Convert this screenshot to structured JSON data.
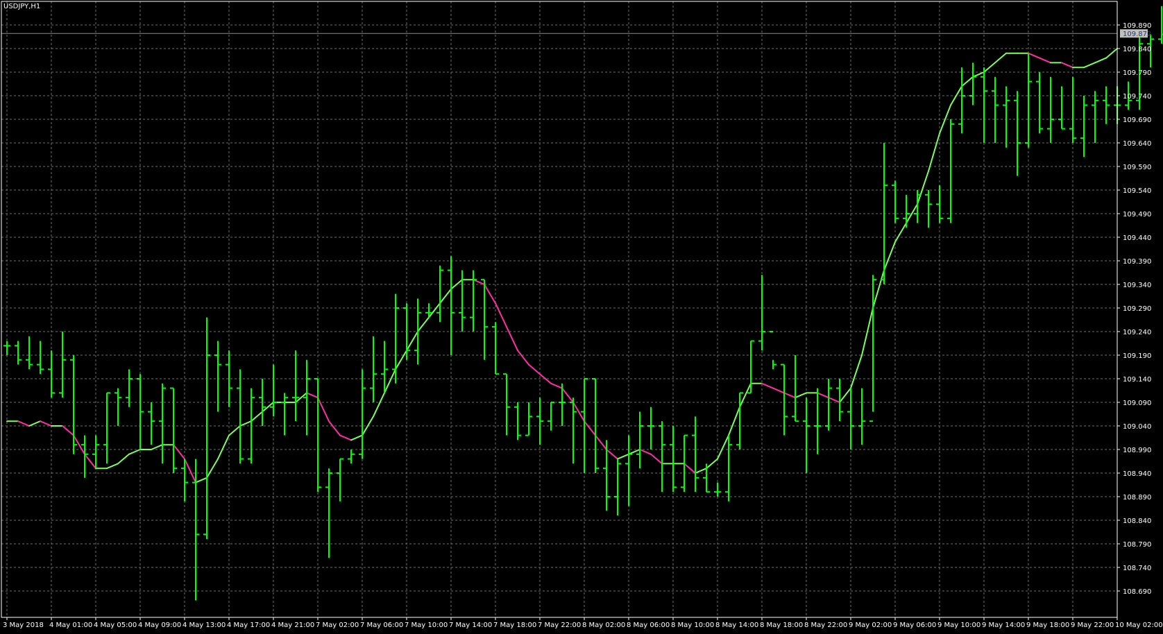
{
  "window": {
    "symbol_label": "USDJPY,H1"
  },
  "colors": {
    "background": "#000000",
    "frame": "#ffffff",
    "grid": "#6e6e6e",
    "bars": "#00ff00",
    "ma_rising": "#7cff5a",
    "ma_falling": "#ff2ea6",
    "price_line": "#8c8c8c",
    "price_tag_bg": "#c0c0c0",
    "price_tag_text": "#1e3a8a",
    "axis_text": "#ffffff"
  },
  "chart_data": {
    "type": "line",
    "subtype": "ohlc-bars-with-moving-average",
    "title": "USDJPY,H1",
    "xlabel": "",
    "ylabel": "",
    "grid": true,
    "ylim": [
      108.65,
      109.93
    ],
    "current_price": 109.872,
    "current_price_label": "109.872",
    "y_ticks": [
      "109.890",
      "109.840",
      "109.790",
      "109.740",
      "109.690",
      "109.640",
      "109.590",
      "109.540",
      "109.490",
      "109.440",
      "109.390",
      "109.340",
      "109.290",
      "109.240",
      "109.190",
      "109.140",
      "109.090",
      "109.040",
      "108.990",
      "108.940",
      "108.890",
      "108.840",
      "108.790",
      "108.740",
      "108.690"
    ],
    "x_ticks": [
      {
        "i": 0,
        "label": "3 May 2018"
      },
      {
        "i": 4,
        "label": "4 May 01:00"
      },
      {
        "i": 8,
        "label": "4 May 05:00"
      },
      {
        "i": 12,
        "label": "4 May 09:00"
      },
      {
        "i": 16,
        "label": "4 May 13:00"
      },
      {
        "i": 20,
        "label": "4 May 17:00"
      },
      {
        "i": 24,
        "label": "4 May 21:00"
      },
      {
        "i": 28,
        "label": "7 May 02:00"
      },
      {
        "i": 32,
        "label": "7 May 06:00"
      },
      {
        "i": 36,
        "label": "7 May 10:00"
      },
      {
        "i": 40,
        "label": "7 May 14:00"
      },
      {
        "i": 44,
        "label": "7 May 18:00"
      },
      {
        "i": 48,
        "label": "7 May 22:00"
      },
      {
        "i": 52,
        "label": "8 May 02:00"
      },
      {
        "i": 56,
        "label": "8 May 06:00"
      },
      {
        "i": 60,
        "label": "8 May 10:00"
      },
      {
        "i": 64,
        "label": "8 May 14:00"
      },
      {
        "i": 68,
        "label": "8 May 18:00"
      },
      {
        "i": 72,
        "label": "8 May 22:00"
      },
      {
        "i": 76,
        "label": "9 May 02:00"
      },
      {
        "i": 80,
        "label": "9 May 06:00"
      },
      {
        "i": 84,
        "label": "9 May 10:00"
      },
      {
        "i": 88,
        "label": "9 May 14:00"
      },
      {
        "i": 92,
        "label": "9 May 18:00"
      },
      {
        "i": 96,
        "label": "9 May 22:00"
      },
      {
        "i": 100,
        "label": "10 May 02:00"
      }
    ],
    "ohlc": [
      [
        109.21,
        109.22,
        109.19,
        109.21
      ],
      [
        109.21,
        109.22,
        109.17,
        109.18
      ],
      [
        109.18,
        109.23,
        109.16,
        109.17
      ],
      [
        109.17,
        109.22,
        109.15,
        109.16
      ],
      [
        109.16,
        109.2,
        109.1,
        109.11
      ],
      [
        109.11,
        109.24,
        109.1,
        109.18
      ],
      [
        109.18,
        109.19,
        108.98,
        109.0
      ],
      [
        109.0,
        109.02,
        108.93,
        108.98
      ],
      [
        108.98,
        109.02,
        108.95,
        109.0
      ],
      [
        109.0,
        109.11,
        108.96,
        109.11
      ],
      [
        109.11,
        109.12,
        109.04,
        109.1
      ],
      [
        109.1,
        109.16,
        109.08,
        109.14
      ],
      [
        109.14,
        109.15,
        108.99,
        109.07
      ],
      [
        109.07,
        109.09,
        109.0,
        109.05
      ],
      [
        109.05,
        109.13,
        108.96,
        109.12
      ],
      [
        109.12,
        109.12,
        108.94,
        108.95
      ],
      [
        108.95,
        108.97,
        108.88,
        108.92
      ],
      [
        108.92,
        108.97,
        108.67,
        108.81
      ],
      [
        108.81,
        109.27,
        108.8,
        109.19
      ],
      [
        109.19,
        109.22,
        109.07,
        109.17
      ],
      [
        109.17,
        109.2,
        109.08,
        109.12
      ],
      [
        109.12,
        109.16,
        108.96,
        108.97
      ],
      [
        108.97,
        109.12,
        108.96,
        109.1
      ],
      [
        109.1,
        109.14,
        109.04,
        109.08
      ],
      [
        109.08,
        109.17,
        109.06,
        109.09
      ],
      [
        109.09,
        109.11,
        109.02,
        109.1
      ],
      [
        109.1,
        109.2,
        109.05,
        109.1
      ],
      [
        109.1,
        109.18,
        109.02,
        109.14
      ],
      [
        109.14,
        109.14,
        108.9,
        108.91
      ],
      [
        108.91,
        108.95,
        108.76,
        108.94
      ],
      [
        108.94,
        108.97,
        108.88,
        108.97
      ],
      [
        108.97,
        108.99,
        108.96,
        108.98
      ],
      [
        108.98,
        109.16,
        108.97,
        109.12
      ],
      [
        109.12,
        109.23,
        109.09,
        109.15
      ],
      [
        109.15,
        109.22,
        109.11,
        109.16
      ],
      [
        109.16,
        109.32,
        109.13,
        109.29
      ],
      [
        109.29,
        109.3,
        109.18,
        109.2
      ],
      [
        109.2,
        109.31,
        109.17,
        109.28
      ],
      [
        109.28,
        109.3,
        109.27,
        109.28
      ],
      [
        109.28,
        109.38,
        109.26,
        109.37
      ],
      [
        109.37,
        109.4,
        109.19,
        109.28
      ],
      [
        109.28,
        109.37,
        109.24,
        109.27
      ],
      [
        109.27,
        109.37,
        109.24,
        109.35
      ],
      [
        109.35,
        109.35,
        109.18,
        109.25
      ],
      [
        109.25,
        109.26,
        109.15,
        109.15
      ],
      [
        109.15,
        109.15,
        109.02,
        109.08
      ],
      [
        109.08,
        109.09,
        109.01,
        109.02
      ],
      [
        109.02,
        109.09,
        109.02,
        109.06
      ],
      [
        109.06,
        109.1,
        109.0,
        109.05
      ],
      [
        109.05,
        109.09,
        109.03,
        109.09
      ],
      [
        109.09,
        109.13,
        109.04,
        109.09
      ],
      [
        109.09,
        109.1,
        108.96,
        109.07
      ],
      [
        109.07,
        109.14,
        108.94,
        109.14
      ],
      [
        109.14,
        109.14,
        108.94,
        108.95
      ],
      [
        108.95,
        109.01,
        108.86,
        108.89
      ],
      [
        108.89,
        108.97,
        108.85,
        108.96
      ],
      [
        108.96,
        109.02,
        108.87,
        108.98
      ],
      [
        108.98,
        109.07,
        108.95,
        109.04
      ],
      [
        109.04,
        109.08,
        108.99,
        109.04
      ],
      [
        109.04,
        109.05,
        108.9,
        109.0
      ],
      [
        109.0,
        109.04,
        108.9,
        108.91
      ],
      [
        108.91,
        109.02,
        108.9,
        109.02
      ],
      [
        109.02,
        109.06,
        108.9,
        108.93
      ],
      [
        108.93,
        108.96,
        108.9,
        108.9
      ],
      [
        108.9,
        108.92,
        108.89,
        108.9
      ],
      [
        108.9,
        109.02,
        108.88,
        109.0
      ],
      [
        109.0,
        109.11,
        108.99,
        109.11
      ],
      [
        109.11,
        109.22,
        109.11,
        109.22
      ],
      [
        109.22,
        109.36,
        109.2,
        109.24
      ],
      [
        109.24,
        109.18,
        109.16,
        109.17
      ],
      [
        109.17,
        109.17,
        109.02,
        109.06
      ],
      [
        109.06,
        109.19,
        109.05,
        109.05
      ],
      [
        109.05,
        109.1,
        108.94,
        109.04
      ],
      [
        109.04,
        109.12,
        108.98,
        109.04
      ],
      [
        109.04,
        109.14,
        109.03,
        109.12
      ],
      [
        109.12,
        109.14,
        109.05,
        109.07
      ],
      [
        109.07,
        109.12,
        108.99,
        109.04
      ],
      [
        109.04,
        109.12,
        109.0,
        109.05
      ],
      [
        109.05,
        109.36,
        109.07,
        109.35
      ],
      [
        109.35,
        109.64,
        109.34,
        109.55
      ],
      [
        109.55,
        109.56,
        109.47,
        109.48
      ],
      [
        109.48,
        109.53,
        109.46,
        109.49
      ],
      [
        109.49,
        109.54,
        109.47,
        109.53
      ],
      [
        109.53,
        109.54,
        109.46,
        109.51
      ],
      [
        109.51,
        109.55,
        109.47,
        109.48
      ],
      [
        109.48,
        109.69,
        109.47,
        109.68
      ],
      [
        109.68,
        109.8,
        109.66,
        109.74
      ],
      [
        109.74,
        109.81,
        109.72,
        109.78
      ],
      [
        109.78,
        109.8,
        109.64,
        109.75
      ],
      [
        109.75,
        109.78,
        109.64,
        109.72
      ],
      [
        109.72,
        109.76,
        109.63,
        109.73
      ],
      [
        109.73,
        109.75,
        109.57,
        109.64
      ],
      [
        109.64,
        109.83,
        109.63,
        109.77
      ],
      [
        109.77,
        109.79,
        109.66,
        109.67
      ],
      [
        109.67,
        109.78,
        109.64,
        109.69
      ],
      [
        109.69,
        109.76,
        109.67,
        109.67
      ],
      [
        109.67,
        109.78,
        109.64,
        109.65
      ],
      [
        109.65,
        109.74,
        109.61,
        109.72
      ],
      [
        109.72,
        109.75,
        109.64,
        109.73
      ],
      [
        109.73,
        109.76,
        109.68,
        109.72
      ],
      [
        109.72,
        109.76,
        109.68,
        109.72
      ],
      [
        109.72,
        109.77,
        109.71,
        109.73
      ],
      [
        109.73,
        109.88,
        109.71,
        109.85
      ],
      [
        109.85,
        109.87,
        109.8,
        109.86
      ],
      [
        109.86,
        109.93,
        109.85,
        109.87
      ]
    ],
    "ma": [
      109.05,
      109.05,
      109.04,
      109.05,
      109.04,
      109.04,
      109.02,
      108.98,
      108.95,
      108.95,
      108.96,
      108.98,
      108.99,
      108.99,
      109.0,
      109.0,
      108.97,
      108.92,
      108.93,
      108.97,
      109.02,
      109.04,
      109.05,
      109.07,
      109.09,
      109.09,
      109.09,
      109.11,
      109.1,
      109.05,
      109.02,
      109.01,
      109.02,
      109.06,
      109.11,
      109.16,
      109.2,
      109.24,
      109.27,
      109.3,
      109.33,
      109.35,
      109.35,
      109.34,
      109.3,
      109.25,
      109.2,
      109.17,
      109.15,
      109.13,
      109.12,
      109.09,
      109.05,
      109.02,
      108.99,
      108.97,
      108.98,
      108.99,
      108.98,
      108.96,
      108.96,
      108.96,
      108.94,
      108.95,
      108.97,
      109.02,
      109.08,
      109.13,
      109.13,
      109.12,
      109.11,
      109.1,
      109.11,
      109.11,
      109.1,
      109.09,
      109.12,
      109.19,
      109.29,
      109.37,
      109.43,
      109.47,
      109.51,
      109.58,
      109.66,
      109.72,
      109.76,
      109.78,
      109.79,
      109.81,
      109.83,
      109.83,
      109.83,
      109.82,
      109.81,
      109.81,
      109.8,
      109.8,
      109.81,
      109.82,
      109.84
    ]
  }
}
